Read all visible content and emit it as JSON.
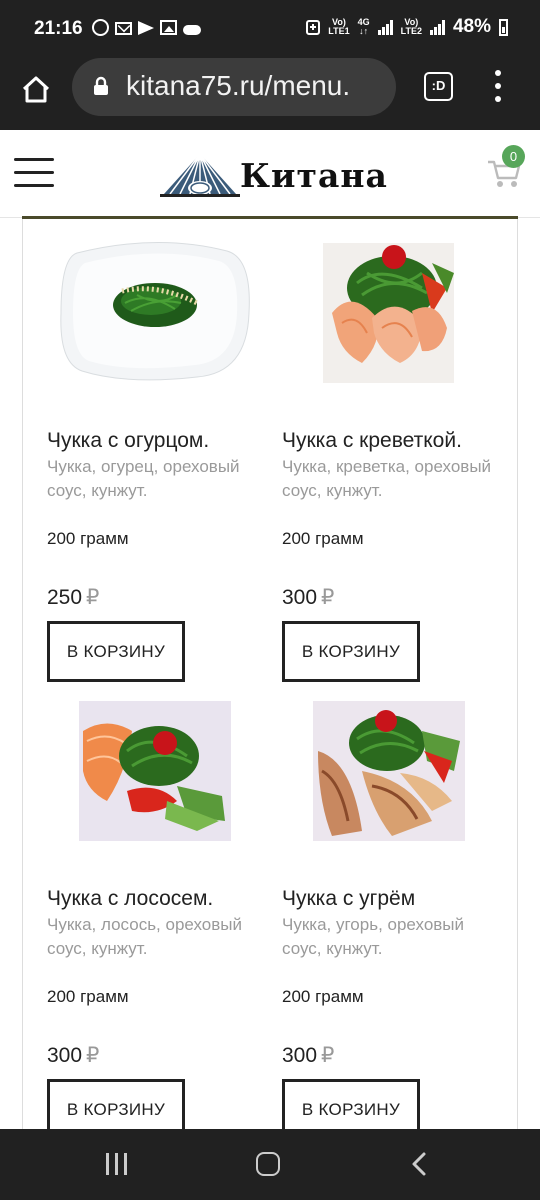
{
  "status_bar": {
    "time": "21:16",
    "battery": "48%",
    "net1": [
      "Vo)",
      "LTE1"
    ],
    "net2": [
      "4G",
      "↓↑"
    ],
    "net3": [
      "Vo)",
      "LTE2"
    ]
  },
  "browser": {
    "url": "kitana75.ru/menu.",
    "tab_label": ":D"
  },
  "header": {
    "logo_text": "Китана",
    "cart_count": "0"
  },
  "products": [
    {
      "name": "Чукка с огурцом.",
      "desc": "Чукка, огурец, ореховый соус, кунжут.",
      "weight": "200 грамм",
      "price": "250",
      "currency": "₽",
      "button": "В КОРЗИНУ"
    },
    {
      "name": "Чукка с креветкой.",
      "desc": "Чукка, креветка, ореховый соус, кунжут.",
      "weight": "200 грамм",
      "price": "300",
      "currency": "₽",
      "button": "В КОРЗИНУ"
    },
    {
      "name": "Чукка с лососем.",
      "desc": "Чукка, лосось, ореховый соус, кунжут.",
      "weight": "200 грамм",
      "price": "300",
      "currency": "₽",
      "button": "В КОРЗИНУ"
    },
    {
      "name": "Чукка с угрём",
      "desc": "Чукка, угорь, ореховый соус, кунжут.",
      "weight": "200 грамм",
      "price": "300",
      "currency": "₽",
      "button": "В КОРЗИНУ"
    }
  ]
}
